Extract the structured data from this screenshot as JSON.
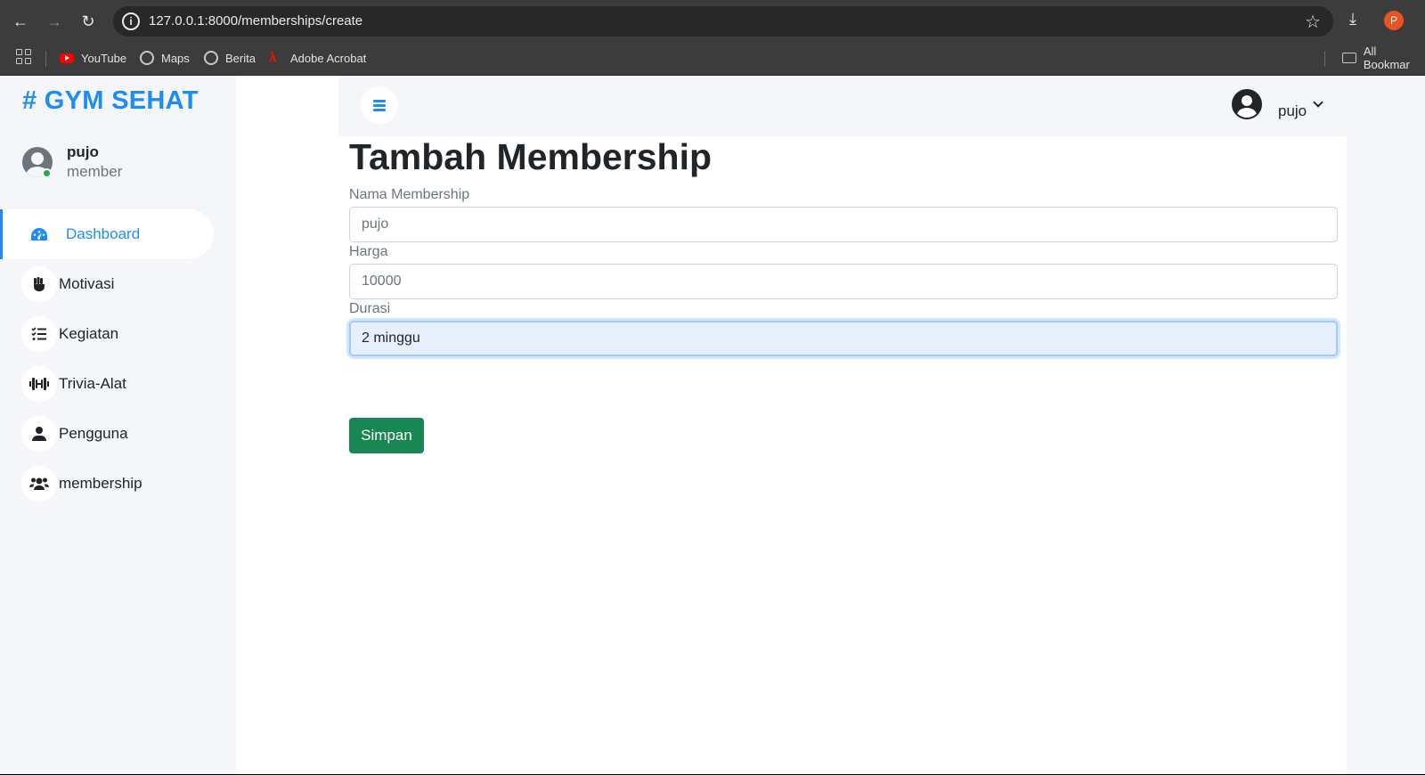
{
  "browser": {
    "url": "127.0.0.1:8000/memberships/create",
    "profile_initial": "P",
    "bookmarks": [
      {
        "label": "YouTube",
        "icon": "youtube-icon"
      },
      {
        "label": "Maps",
        "icon": "globe-icon"
      },
      {
        "label": "Berita",
        "icon": "globe-icon"
      },
      {
        "label": "Adobe Acrobat",
        "icon": "acrobat-icon"
      }
    ],
    "all_bookmarks": "All Bookmar"
  },
  "sidebar": {
    "brand": "# GYM SEHAT",
    "user": {
      "name": "pujo",
      "role": "member"
    },
    "items": [
      {
        "label": "Dashboard",
        "icon": "dashboard-icon",
        "active": true
      },
      {
        "label": "Motivasi",
        "icon": "fist-icon"
      },
      {
        "label": "Kegiatan",
        "icon": "list-icon"
      },
      {
        "label": "Trivia-Alat",
        "icon": "dumbbell-icon"
      },
      {
        "label": "Pengguna",
        "icon": "user-icon"
      },
      {
        "label": "membership",
        "icon": "users-icon"
      }
    ]
  },
  "topbar": {
    "account_name": "pujo"
  },
  "form": {
    "title": "Tambah Membership",
    "fields": [
      {
        "label": "Nama Membership",
        "value": "pujo"
      },
      {
        "label": "Harga",
        "value": "10000"
      },
      {
        "label": "Durasi",
        "value": "2 minggu"
      }
    ],
    "submit_label": "Simpan"
  },
  "colors": {
    "accent": "#1d8cf8",
    "success": "#198754",
    "sidebar_bg": "#f4f6f9"
  }
}
